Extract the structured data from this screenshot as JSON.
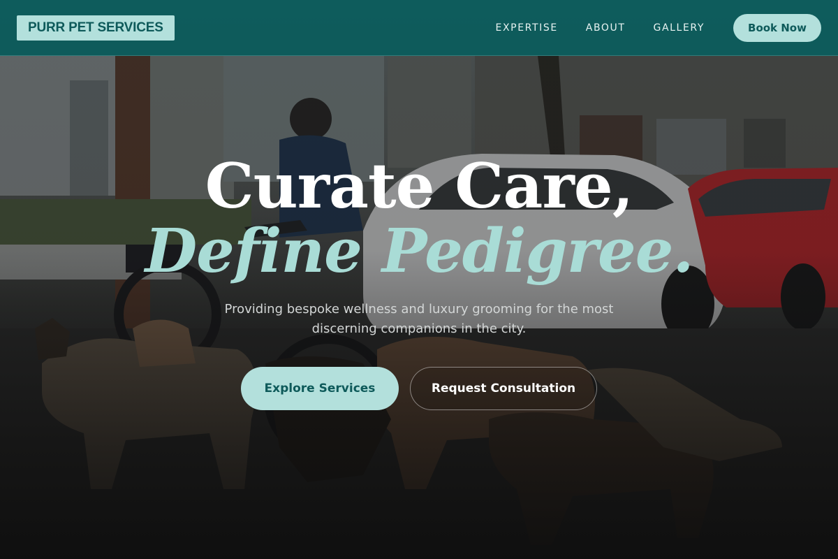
{
  "header": {
    "logo": "PURR PET SERVICES",
    "nav": [
      "EXPERTISE",
      "ABOUT",
      "GALLERY"
    ],
    "book_button": "Book Now"
  },
  "hero": {
    "headline_line1": "Curate Care,",
    "headline_line2": "Define Pedigree.",
    "subtitle": "Providing bespoke wellness and luxury grooming for the most discerning companions in the city.",
    "primary_cta": "Explore Services",
    "secondary_cta": "Request Consultation"
  },
  "colors": {
    "header_bg": "#0a5c5c",
    "accent": "#b3e0dc",
    "accent_text": "#0e5a5a",
    "headline_italic": "#a9dcd6"
  }
}
